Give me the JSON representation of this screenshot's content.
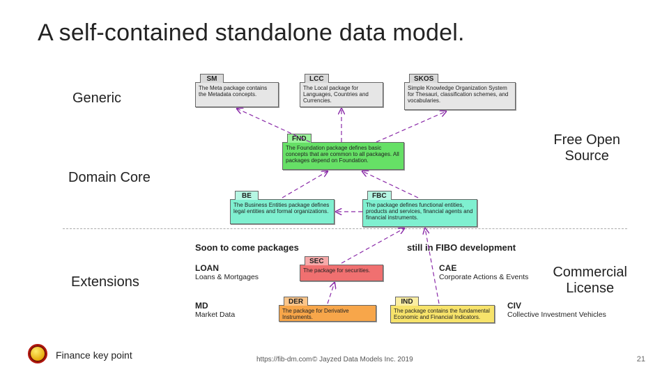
{
  "title": "A self-contained standalone data model.",
  "labels": {
    "generic": "Generic",
    "domain": "Domain Core",
    "extensions": "Extensions",
    "free": "Free Open\nSource",
    "commercial": "Commercial\nLicense"
  },
  "sections": {
    "soon": "Soon to come packages",
    "still": "still in FIBO development"
  },
  "pkg": {
    "sm": {
      "code": "SM",
      "desc": "The Meta package contains the Metadata concepts."
    },
    "lcc": {
      "code": "LCC",
      "desc": "The Local package for Languages, Countries and Currencies."
    },
    "skos": {
      "code": "SKOS",
      "desc": "Simple Knowledge Organization System for Thesauri, classification schemes, and vocabularies."
    },
    "fnd": {
      "code": "FND",
      "desc": "The Foundation package defines basic concepts that are common to all packages. All packages depend on Foundation."
    },
    "be": {
      "code": "BE",
      "desc": "The Business Entities package defines legal entities and formal organizations."
    },
    "fbc": {
      "code": "FBC",
      "desc": "The package defines functional entities, products and services, financial agents and financial instruments."
    },
    "sec": {
      "code": "SEC",
      "desc": "The package for securities."
    },
    "der": {
      "code": "DER",
      "desc": "The package for Derivative Instruments."
    },
    "ind": {
      "code": "IND",
      "desc": "The package contains the fundamental Economic and Financial Indicators."
    }
  },
  "ext": {
    "loan": {
      "code": "LOAN",
      "txt": "Loans & Mortgages"
    },
    "md": {
      "code": "MD",
      "txt": "Market Data"
    },
    "cae": {
      "code": "CAE",
      "txt": "Corporate Actions & Events"
    },
    "civ": {
      "code": "CIV",
      "txt": "Collective Investment Vehicles"
    }
  },
  "footer": {
    "note": "Finance key point",
    "url": "https://fib-dm.com",
    "copyright": "© Jayzed Data Models Inc. 2019",
    "page": "21"
  }
}
